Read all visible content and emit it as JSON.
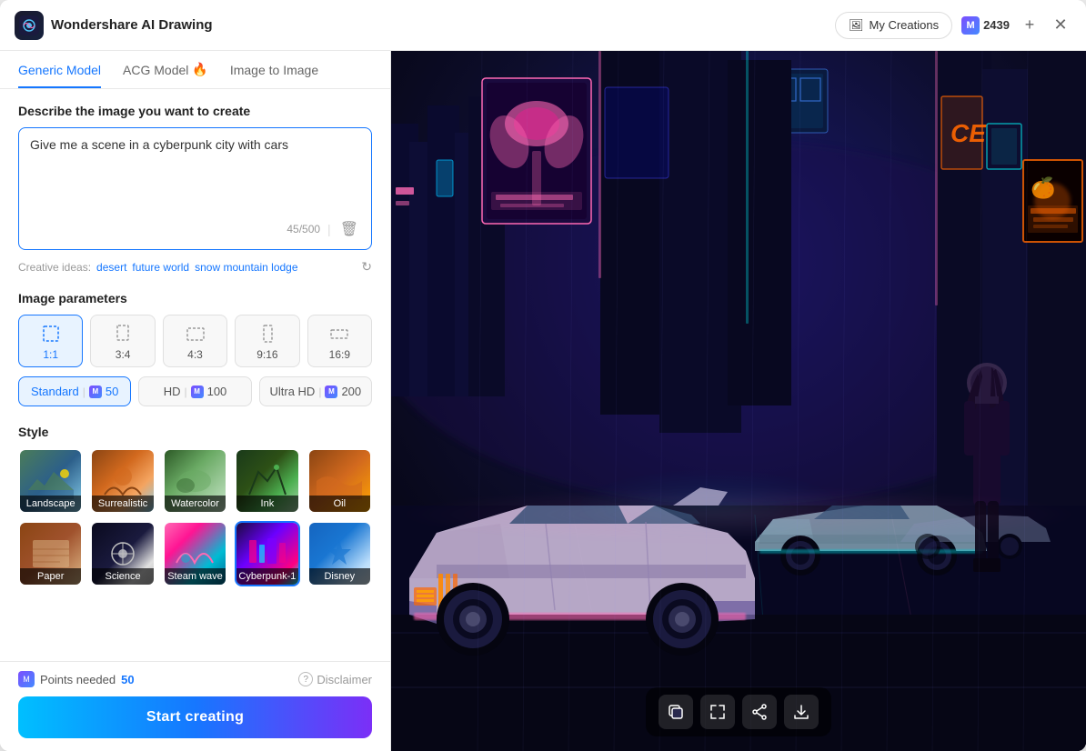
{
  "titleBar": {
    "appName": "Wondershare AI Drawing",
    "myCreationsLabel": "My Creations",
    "points": "2439",
    "addLabel": "+",
    "closeLabel": "✕"
  },
  "tabs": [
    {
      "id": "generic",
      "label": "Generic Model",
      "active": true,
      "badge": null
    },
    {
      "id": "acg",
      "label": "ACG Model",
      "active": false,
      "badge": "🔥"
    },
    {
      "id": "img2img",
      "label": "Image to Image",
      "active": false,
      "badge": null
    }
  ],
  "prompt": {
    "sectionLabel": "Describe the image you want to create",
    "value": "Give me a scene in a cyberpunk city with cars",
    "charCount": "45/500",
    "placeholder": "Describe the image you want to create"
  },
  "creativeIdeas": {
    "label": "Creative ideas:",
    "ideas": [
      "desert",
      "future world",
      "snow mountain lodge"
    ]
  },
  "imageParams": {
    "sectionLabel": "Image parameters",
    "aspectRatios": [
      {
        "label": "1:1",
        "active": true
      },
      {
        "label": "3:4",
        "active": false
      },
      {
        "label": "4:3",
        "active": false
      },
      {
        "label": "9:16",
        "active": false
      },
      {
        "label": "16:9",
        "active": false
      }
    ],
    "qualities": [
      {
        "label": "Standard",
        "points": "50",
        "active": true
      },
      {
        "label": "HD",
        "points": "100",
        "active": false
      },
      {
        "label": "Ultra HD",
        "points": "200",
        "active": false
      }
    ]
  },
  "style": {
    "sectionLabel": "Style",
    "items": [
      {
        "id": "landscape",
        "label": "Landscape",
        "active": false,
        "swatch": "landscape"
      },
      {
        "id": "surrealistic",
        "label": "Surrealistic",
        "active": false,
        "swatch": "surrealistic"
      },
      {
        "id": "watercolor",
        "label": "Watercolor",
        "active": false,
        "swatch": "watercolor"
      },
      {
        "id": "ink",
        "label": "Ink",
        "active": false,
        "swatch": "ink"
      },
      {
        "id": "oil",
        "label": "Oil",
        "active": false,
        "swatch": "oil"
      },
      {
        "id": "paper",
        "label": "Paper",
        "active": false,
        "swatch": "paper"
      },
      {
        "id": "science",
        "label": "Science",
        "active": false,
        "swatch": "science"
      },
      {
        "id": "steam",
        "label": "Steam wave",
        "active": false,
        "swatch": "steam"
      },
      {
        "id": "cyberpunk",
        "label": "Cyberpunk-1",
        "active": true,
        "swatch": "cyberpunk"
      },
      {
        "id": "disney",
        "label": "Disney",
        "active": false,
        "swatch": "disney"
      }
    ]
  },
  "bottomBar": {
    "pointsLabel": "Points needed",
    "pointsValue": "50",
    "disclaimerLabel": "Disclaimer",
    "startLabel": "Start creating"
  },
  "previewTools": [
    {
      "id": "copy",
      "icon": "⊞",
      "label": "copy-icon"
    },
    {
      "id": "expand",
      "icon": "⤢",
      "label": "expand-icon"
    },
    {
      "id": "share",
      "icon": "⤴",
      "label": "share-icon"
    },
    {
      "id": "download",
      "icon": "⬇",
      "label": "download-icon"
    }
  ]
}
